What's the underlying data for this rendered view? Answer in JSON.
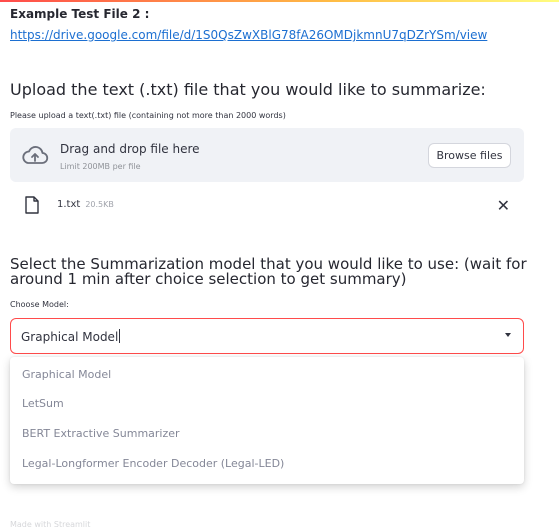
{
  "test_file": {
    "label": "Example Test File 2 :",
    "link": "https://drive.google.com/file/d/1S0QsZwXBlG78fA26OMDjkmnU7qDZrYSm/view"
  },
  "upload": {
    "title": "Upload the text (.txt) file that you would like to summarize:",
    "subtitle": "Please upload a text(.txt) file (containing not more than 2000 words)",
    "drop_text": "Drag and drop file here",
    "limit_text": "Limit 200MB per file",
    "browse_label": "Browse files",
    "file": {
      "name": "1.txt",
      "size": "20.5KB"
    }
  },
  "model": {
    "title": "Select the Summarization model that you would like to use: (wait for around 1 min after choice selection to get summary)",
    "label": "Choose Model:",
    "selected": "Graphical Model",
    "options": [
      "Graphical Model",
      "LetSum",
      "BERT Extractive Summarizer",
      "Legal-Longformer Encoder Decoder (Legal-LED)"
    ]
  },
  "footer": {
    "ghost_text": "Made with Streamlit"
  },
  "colors": {
    "accent": "#ff4b4b",
    "link": "#1c6fd1",
    "dropzone": "#f0f2f6"
  },
  "icons": {
    "cloud": "cloud-upload-icon",
    "file": "file-icon",
    "close": "close-icon",
    "chevron": "chevron-down-icon"
  }
}
